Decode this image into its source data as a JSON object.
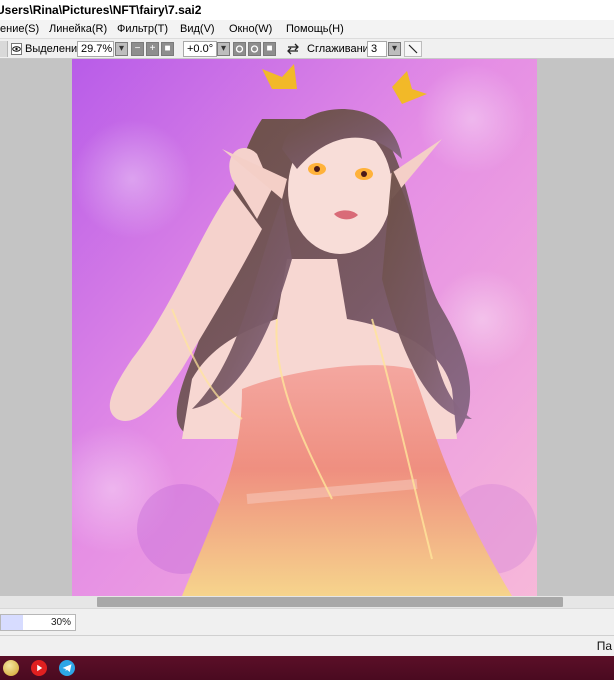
{
  "window": {
    "title": "Users\\Rina\\Pictures\\NFT\\fairy\\7.sai2"
  },
  "menu": [
    "ение(S)",
    "Линейка(R)",
    "Фильтр(T)",
    "Вид(V)",
    "Окно(W)",
    "Помощь(H)"
  ],
  "toolbar": {
    "selection_label": "Выделение",
    "zoom_value": "29.7%",
    "minus_label": "−",
    "plus_label": "+",
    "reset_label": "■",
    "rotation_value": "+0.0°",
    "smoothing_label": "Сглаживание",
    "smoothing_value": "3",
    "dropdown_glyph": "▾"
  },
  "progress": {
    "value": 0.3,
    "text": "30%"
  },
  "status": {
    "right_text": "Па"
  },
  "taskbar": {
    "icons": [
      "app-icon",
      "youtube-icon",
      "telegram-icon"
    ]
  },
  "colors": {
    "workspace": "#c4c4c4",
    "taskbar": "#4f0b22",
    "progress_fill": "#d7dcff"
  }
}
